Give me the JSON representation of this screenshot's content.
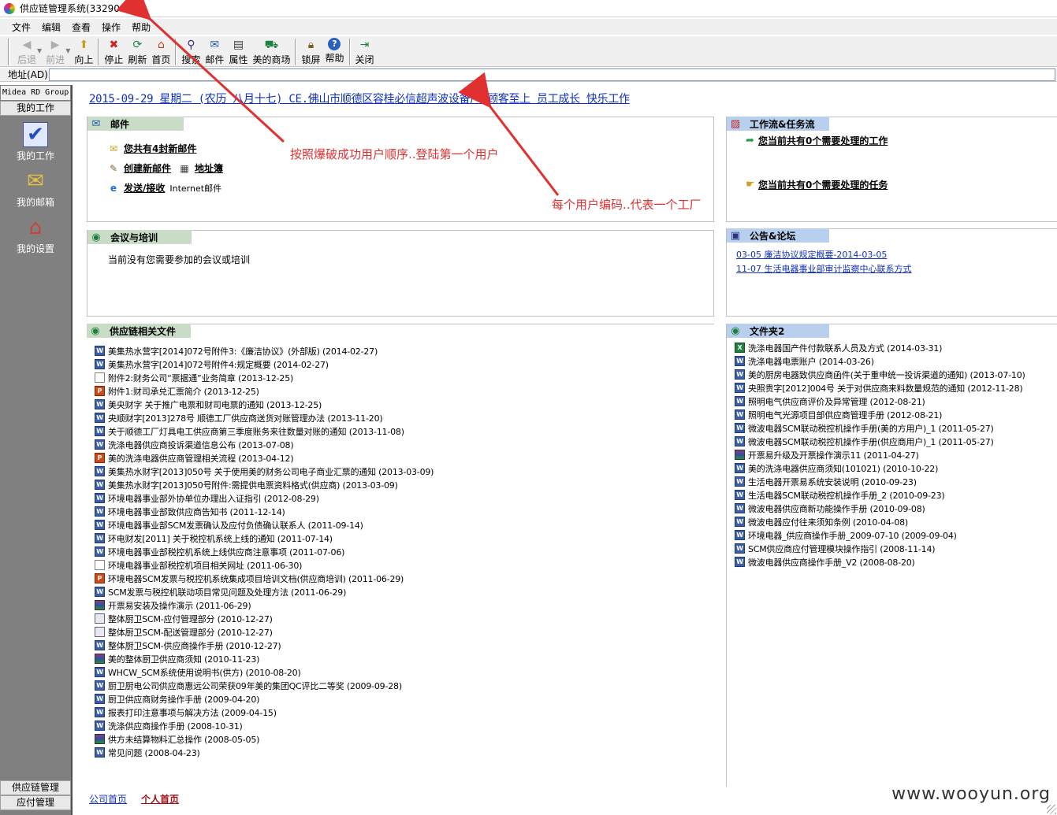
{
  "window": {
    "title": "供应链管理系统(332900073)"
  },
  "menu": [
    "文件",
    "编辑",
    "查看",
    "操作",
    "帮助"
  ],
  "toolbar": {
    "back": "后退",
    "forward": "前进",
    "up": "向上",
    "stop": "停止",
    "refresh": "刷新",
    "home": "首页",
    "search": "搜索",
    "mail": "邮件",
    "properties": "属性",
    "mall": "美的商场",
    "lock": "锁屏",
    "help": "帮助",
    "close": "关闭"
  },
  "address": {
    "label": "地址(AD)",
    "value": ""
  },
  "sidebar": {
    "header": "Midea RD Group",
    "section": "我的工作",
    "items": [
      "我的工作",
      "我的邮箱",
      "我的设置"
    ],
    "bottom": [
      "供应链管理",
      "应付管理"
    ]
  },
  "date_line": "2015-09-29 星期二 (农历 八月十七) CE.佛山市顺德区容桂必信超声波设备厂 顾客至上 员工成长 快乐工作",
  "mail": {
    "title": "邮件",
    "new_mail": "您共有4封新邮件",
    "create": "创建新邮件",
    "addressbook": "地址簿",
    "send_receive": "发送/接收",
    "internet_mail": "Internet邮件"
  },
  "meeting": {
    "title": "会议与培训",
    "empty": "当前没有您需要参加的会议或培训"
  },
  "supply_docs": {
    "title": "供应链相关文件",
    "items": [
      {
        "t": "美集热水营字[2014]072号附件3:《廉洁协议》(外部版) (2014-02-27)",
        "ic": "word"
      },
      {
        "t": "美集热水营字[2014]072号附件4:规定概要 (2014-02-27)",
        "ic": "word"
      },
      {
        "t": "附件2:财务公司“票据通”业务简章 (2013-12-25)",
        "ic": "txt"
      },
      {
        "t": "附件1:财司承兑汇票简介 (2013-12-25)",
        "ic": "ppt"
      },
      {
        "t": "美央财字 关于推广电票和财司电票的通知 (2013-12-25)",
        "ic": "word"
      },
      {
        "t": "央顺财字[2013]278号 顺德工厂供应商送货对账管理办法 (2013-11-20)",
        "ic": "word"
      },
      {
        "t": "关于顺德工厂灯具电工供应商第三季度账务来往数量对账的通知 (2013-11-08)",
        "ic": "word"
      },
      {
        "t": "洗涤电器供应商投诉渠道信息公布 (2013-07-08)",
        "ic": "word"
      },
      {
        "t": "美的洗涤电器供应商管理相关流程 (2013-04-12)",
        "ic": "ppt"
      },
      {
        "t": "美集热水财字[2013]050号 关于使用美的财务公司电子商业汇票的通知 (2013-03-09)",
        "ic": "word"
      },
      {
        "t": "美集热水财字[2013]050号附件:需提供电票资料格式(供应商) (2013-03-09)",
        "ic": "word"
      },
      {
        "t": "环境电器事业部外协单位办理出入证指引 (2012-08-29)",
        "ic": "word"
      },
      {
        "t": "环境电器事业部致供应商告知书 (2011-12-14)",
        "ic": "word"
      },
      {
        "t": "环境电器事业部SCM发票确认及应付负债确认联系人 (2011-09-14)",
        "ic": "word"
      },
      {
        "t": "环电财发[2011] 关于税控机系统上线的通知 (2011-07-14)",
        "ic": "word"
      },
      {
        "t": "环境电器事业部税控机系统上线供应商注意事项 (2011-07-06)",
        "ic": "word"
      },
      {
        "t": "环境电器事业部税控机项目相关网址 (2011-06-30)",
        "ic": "txt"
      },
      {
        "t": "环境电器SCM发票与税控机系统集成项目培训文档(供应商培训) (2011-06-29)",
        "ic": "ppt"
      },
      {
        "t": "SCM发票与税控机联动项目常见问题及处理方法 (2011-06-29)",
        "ic": "word"
      },
      {
        "t": "开票易安装及操作演示 (2011-06-29)",
        "ic": "rar"
      },
      {
        "t": "整体厨卫SCM-应付管理部分 (2010-12-27)",
        "ic": "gen"
      },
      {
        "t": "整体厨卫SCM-配送管理部分 (2010-12-27)",
        "ic": "gen"
      },
      {
        "t": "整体厨卫SCM-供应商操作手册 (2010-12-27)",
        "ic": "word"
      },
      {
        "t": "美的整体厨卫供应商须知 (2010-11-23)",
        "ic": "rar"
      },
      {
        "t": "WHCW_SCM系统使用说明书(供方) (2010-08-20)",
        "ic": "word"
      },
      {
        "t": "厨卫厨电公司供应商惠远公司荣获09年美的集团QC评比二等奖 (2009-09-28)",
        "ic": "word"
      },
      {
        "t": "厨卫供应商财务操作手册 (2009-04-20)",
        "ic": "word"
      },
      {
        "t": "报表打印注意事项与解决方法 (2009-04-15)",
        "ic": "word"
      },
      {
        "t": "洗涤供应商操作手册 (2008-10-31)",
        "ic": "word"
      },
      {
        "t": "供方未结算物料汇总操作 (2008-05-05)",
        "ic": "rar"
      },
      {
        "t": "常见问题 (2008-04-23)",
        "ic": "word"
      }
    ]
  },
  "workflow": {
    "title": "工作流&任务流",
    "work": "您当前共有0个需要处理的工作",
    "task": "您当前共有0个需要处理的任务"
  },
  "notice": {
    "title": "公告&论坛",
    "items": [
      "03-05 廉洁协议规定概要-2014-03-05",
      "11-07 生活电器事业部审计监察中心联系方式"
    ]
  },
  "folder2": {
    "title": "文件夹2",
    "items": [
      {
        "t": "洗涤电器国产件付款联系人员及方式 (2014-03-31)",
        "ic": "excel"
      },
      {
        "t": "洗涤电器电票账户 (2014-03-26)",
        "ic": "word"
      },
      {
        "t": "美的厨房电器致供应商函件(关于重申统一投诉渠道的通知) (2013-07-10)",
        "ic": "word"
      },
      {
        "t": "央照贵字[2012]004号 关于对供应商来料数量规范的通知 (2012-11-28)",
        "ic": "word"
      },
      {
        "t": "照明电气供应商评价及异常管理 (2012-08-21)",
        "ic": "word"
      },
      {
        "t": "照明电气光源项目部供应商管理手册 (2012-08-21)",
        "ic": "word"
      },
      {
        "t": "微波电器SCM联动税控机操作手册(美的方用户)_1 (2011-05-27)",
        "ic": "word"
      },
      {
        "t": "微波电器SCM联动税控机操作手册(供应商用户)_1 (2011-05-27)",
        "ic": "word"
      },
      {
        "t": "开票易升级及开票操作演示11 (2011-04-27)",
        "ic": "rar"
      },
      {
        "t": "美的洗涤电器供应商须知(101021) (2010-10-22)",
        "ic": "word"
      },
      {
        "t": "生活电器开票易系统安装说明 (2010-09-23)",
        "ic": "word"
      },
      {
        "t": "生活电器SCM联动税控机操作手册_2 (2010-09-23)",
        "ic": "word"
      },
      {
        "t": "微波电器供应商新功能操作手册 (2010-09-08)",
        "ic": "word"
      },
      {
        "t": "微波电器应付往来须知条例 (2010-04-08)",
        "ic": "word"
      },
      {
        "t": "环境电器_供应商操作手册_2009-07-10 (2009-09-04)",
        "ic": "word"
      },
      {
        "t": "SCM供应商应付管理模块操作指引 (2008-11-14)",
        "ic": "word"
      },
      {
        "t": "微波电器供应商操作手册_V2 (2008-08-20)",
        "ic": "word"
      }
    ]
  },
  "footer": {
    "company_home": "公司首页",
    "personal_home": "个人首页"
  },
  "annotations": {
    "note1": "按照爆破成功用户顺序..登陆第一个用户",
    "note2": "每个用户编码..代表一个工厂",
    "color": "#e03030"
  },
  "watermark": "www.wooyun.org"
}
